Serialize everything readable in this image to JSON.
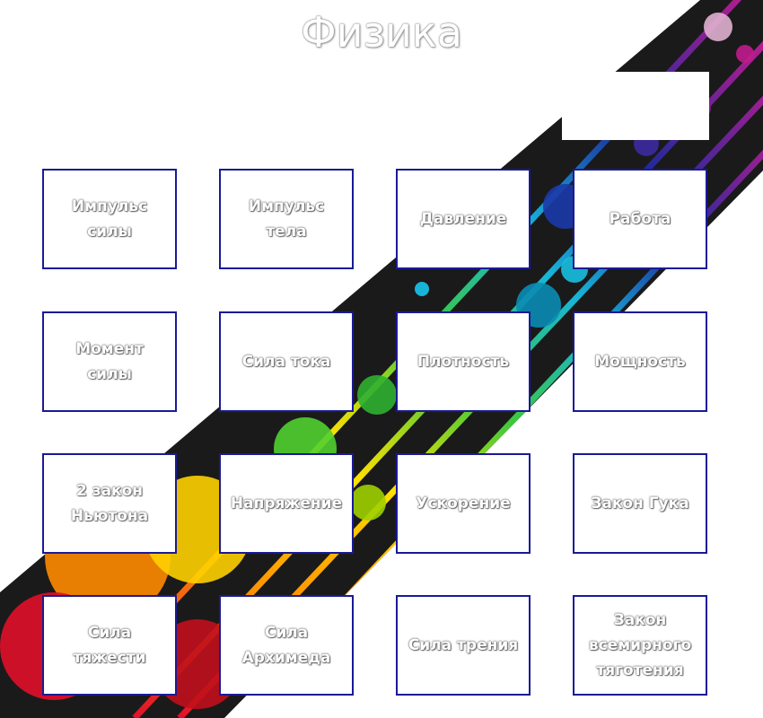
{
  "title": "Физика",
  "cards": [
    "Импульс\nсилы",
    "Импульс\nтела",
    "Давление",
    "Работа",
    "Момент\nсилы",
    "Сила тока",
    "Плотность",
    "Мощность",
    "2 закон\nНьютона",
    "Напряжение",
    "Ускорение",
    "Закон Гука",
    "Сила\nтяжести",
    "Сила\nАрхимеда",
    "Сила трения",
    "Закон\nвсемирного\nтяготения"
  ]
}
